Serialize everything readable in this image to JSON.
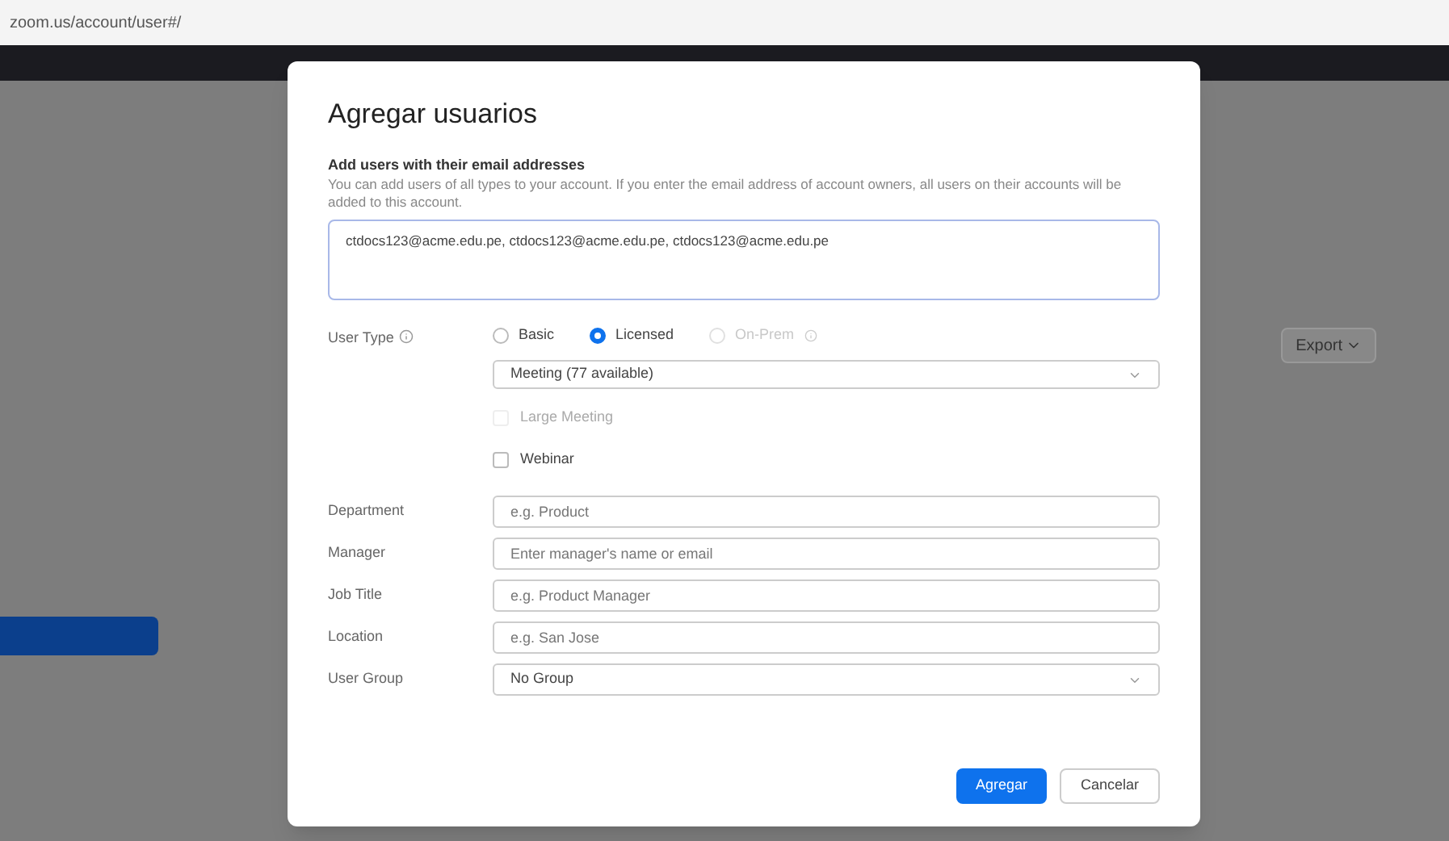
{
  "browser": {
    "address": "zoom.us/account/user#/"
  },
  "background": {
    "export_button": "Export"
  },
  "dialog": {
    "title": "Agregar usuarios",
    "section_title": "Add users with their email addresses",
    "description": "You can add users of all types to your account. If you enter the email address of account owners, all users on their accounts will be added to this account.",
    "emails": "ctdocs123@acme.edu.pe, ctdocs123@acme.edu.pe, ctdocs123@acme.edu.pe",
    "user_type": {
      "label": "User Type",
      "options": [
        {
          "label": "Basic",
          "selected": false,
          "disabled": false
        },
        {
          "label": "Licensed",
          "selected": true,
          "disabled": false
        },
        {
          "label": "On-Prem",
          "selected": false,
          "disabled": true
        }
      ],
      "license_select": "Meeting (77 available)",
      "addons": [
        {
          "label": "Large Meeting",
          "checked": false,
          "disabled": true
        },
        {
          "label": "Webinar",
          "checked": false,
          "disabled": false
        }
      ]
    },
    "fields": [
      {
        "kind": "input",
        "label": "Department",
        "placeholder": "e.g. Product"
      },
      {
        "kind": "input",
        "label": "Manager",
        "placeholder": "Enter manager's name or email"
      },
      {
        "kind": "input",
        "label": "Job Title",
        "placeholder": "e.g. Product Manager"
      },
      {
        "kind": "input",
        "label": "Location",
        "placeholder": "e.g. San Jose"
      },
      {
        "kind": "select",
        "label": "User Group",
        "value": "No Group"
      }
    ],
    "buttons": [
      {
        "label": "Agregar",
        "kind": "primary"
      },
      {
        "label": "Cancelar",
        "kind": "secondary"
      }
    ]
  }
}
